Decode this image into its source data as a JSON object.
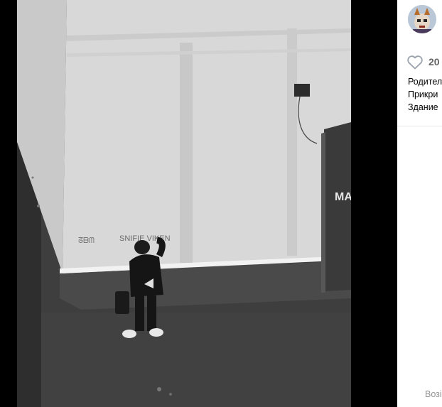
{
  "post": {
    "like_count": "20",
    "caption_lines": [
      "Родител",
      "Прикри",
      "Здание"
    ],
    "footer_link": "Возі"
  },
  "icons": {
    "like": "heart-outline-icon",
    "author": "avatar"
  },
  "colors": {
    "viewer_bg": "#000000",
    "panel_bg": "#ffffff",
    "muted_text": "#656565"
  }
}
